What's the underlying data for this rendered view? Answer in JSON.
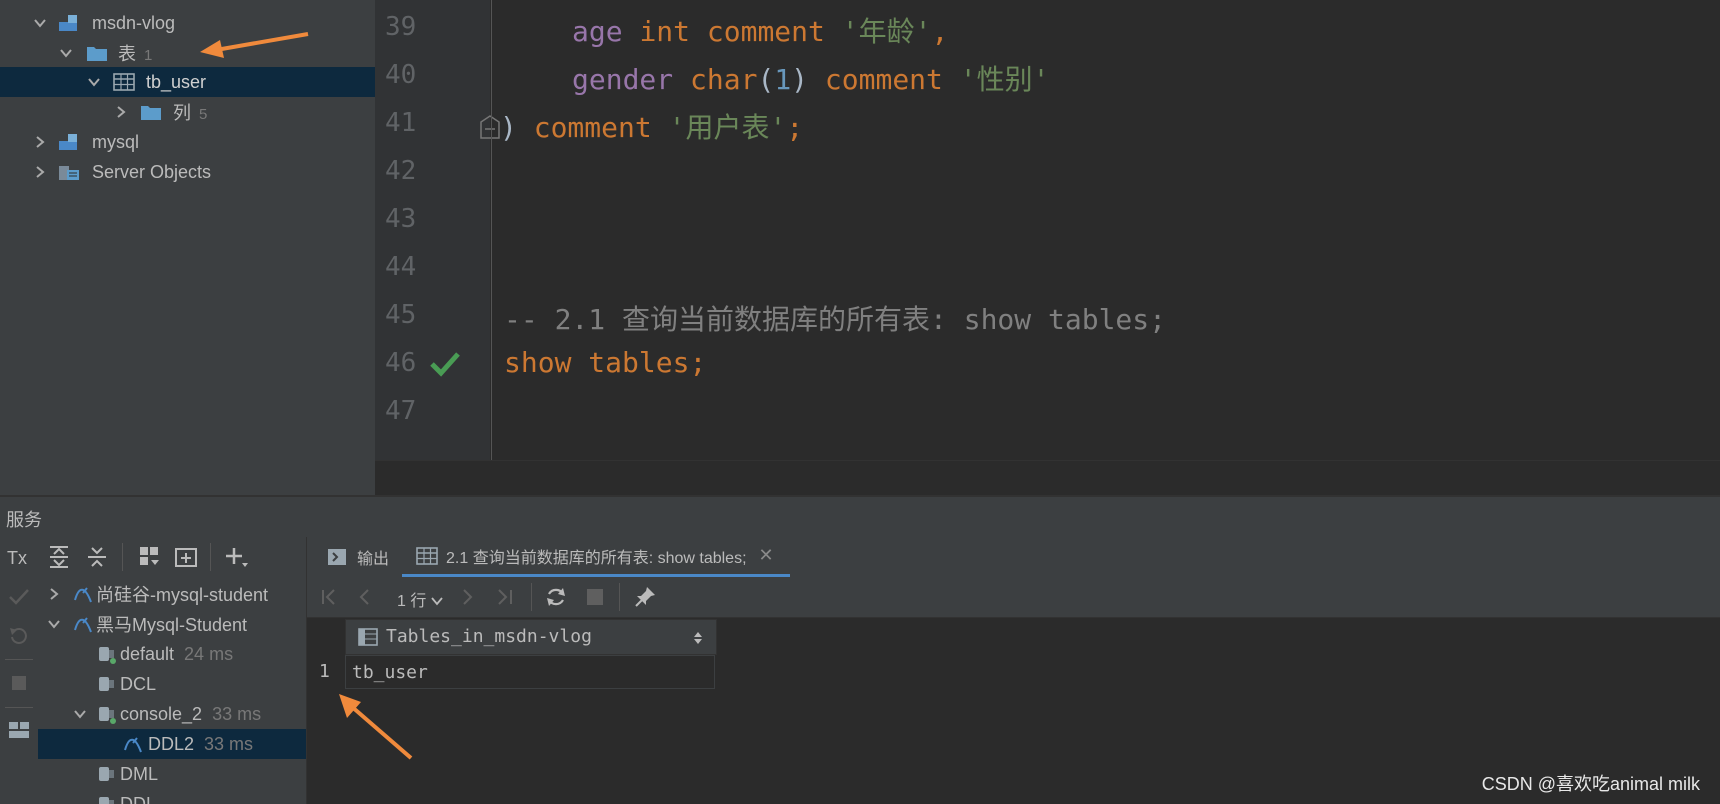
{
  "db_tree": {
    "items": [
      {
        "label": "msdn-vlog",
        "count": ""
      },
      {
        "label": "表",
        "count": "1"
      },
      {
        "label": "tb_user",
        "count": ""
      },
      {
        "label": "列",
        "count": "5"
      },
      {
        "label": "mysql",
        "count": ""
      },
      {
        "label": "Server Objects",
        "count": ""
      }
    ]
  },
  "editor": {
    "line_numbers": [
      "39",
      "40",
      "41",
      "42",
      "43",
      "44",
      "45",
      "46",
      "47"
    ],
    "lines": {
      "l39": {
        "field": "age",
        "type": "int",
        "kw": "comment",
        "str": "'年龄'",
        "punct": ","
      },
      "l40": {
        "field": "gender",
        "type": "char",
        "open": "(",
        "num": "1",
        "close": ")",
        "kw": "comment",
        "str": "'性别'"
      },
      "l41": {
        "paren": ")",
        "kw": "comment",
        "str": "'用户表'",
        "punct": ";"
      },
      "l45": {
        "comment": "-- 2.1 查询当前数据库的所有表: show tables;"
      },
      "l46": {
        "kw": "show tables",
        "punct": ";"
      }
    }
  },
  "services": {
    "title": "服务",
    "tx_label": "Tx",
    "tree": [
      {
        "label": "尚硅谷-mysql-student",
        "ms": ""
      },
      {
        "label": "黑马Mysql-Student",
        "ms": ""
      },
      {
        "label": "default",
        "ms": "24 ms"
      },
      {
        "label": "DCL",
        "ms": ""
      },
      {
        "label": "console_2",
        "ms": "33 ms"
      },
      {
        "label": "DDL2",
        "ms": "33 ms"
      },
      {
        "label": "DML",
        "ms": ""
      },
      {
        "label": "DDL",
        "ms": ""
      }
    ]
  },
  "results": {
    "tabs": [
      {
        "label": "输出"
      },
      {
        "label": "2.1 查询当前数据库的所有表: show tables;"
      }
    ],
    "row_count": "1 行",
    "column_header": "Tables_in_msdn-vlog",
    "rows": [
      {
        "num": "1",
        "value": "tb_user"
      }
    ]
  },
  "watermark": "CSDN @喜欢吃animal milk",
  "colors": {
    "keyword": "#cc7832",
    "field": "#9876aa",
    "string": "#6a8759",
    "number": "#6897bb",
    "comment": "#808080",
    "selection": "#0d293e",
    "arrow": "#f08a3c",
    "check": "#499c54"
  }
}
